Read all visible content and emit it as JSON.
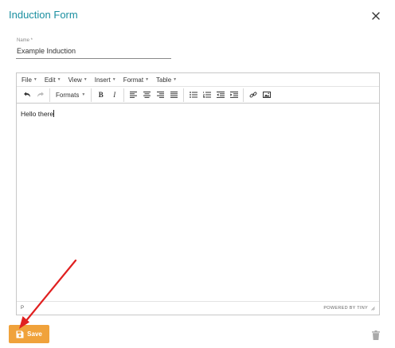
{
  "dialog": {
    "title": "Induction Form",
    "close_icon": "close-icon"
  },
  "name_field": {
    "label": "Name *",
    "value": "Example Induction"
  },
  "editor": {
    "menubar": [
      {
        "label": "File"
      },
      {
        "label": "Edit"
      },
      {
        "label": "View"
      },
      {
        "label": "Insert"
      },
      {
        "label": "Format"
      },
      {
        "label": "Table"
      }
    ],
    "toolbar": {
      "formats_label": "Formats",
      "bold_label": "B",
      "italic_label": "I"
    },
    "content": "Hello there",
    "status_path": "P",
    "status_brand": "POWERED BY TINY"
  },
  "footer": {
    "save_label": "Save"
  },
  "colors": {
    "title": "#1a8fa0",
    "save_button": "#f0a23b",
    "annotation_arrow": "#e02020"
  }
}
